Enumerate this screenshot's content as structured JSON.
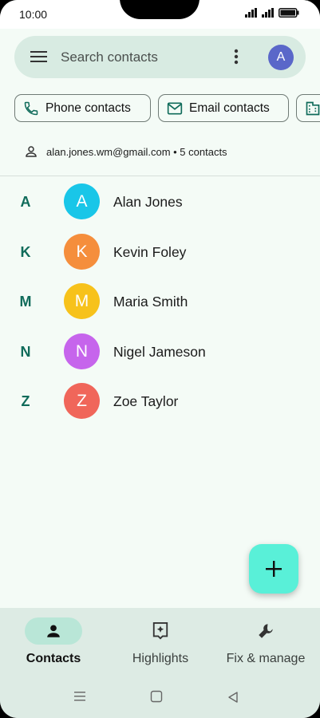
{
  "status": {
    "time": "10:00"
  },
  "search": {
    "placeholder": "Search contacts",
    "avatar_letter": "A"
  },
  "chips": [
    {
      "label": "Phone contacts",
      "icon": "phone-icon"
    },
    {
      "label": "Email contacts",
      "icon": "mail-icon"
    },
    {
      "label": "",
      "icon": "building-icon"
    }
  ],
  "account": {
    "text": "alan.jones.wm@gmail.com • 5 contacts"
  },
  "contacts": [
    {
      "letter": "A",
      "initial": "A",
      "name": "Alan Jones",
      "color": "#19c6e8"
    },
    {
      "letter": "K",
      "initial": "K",
      "name": "Kevin Foley",
      "color": "#f58e3c"
    },
    {
      "letter": "M",
      "initial": "M",
      "name": "Maria Smith",
      "color": "#f7c21b"
    },
    {
      "letter": "N",
      "initial": "N",
      "name": "Nigel Jameson",
      "color": "#c665ec"
    },
    {
      "letter": "Z",
      "initial": "Z",
      "name": "Zoe Taylor",
      "color": "#f0665a"
    }
  ],
  "nav": [
    {
      "label": "Contacts",
      "icon": "person-icon",
      "active": true
    },
    {
      "label": "Highlights",
      "icon": "highlights-icon",
      "active": false
    },
    {
      "label": "Fix & manage",
      "icon": "wrench-icon",
      "active": false
    }
  ],
  "colors": {
    "accent": "#0f6b5a",
    "fab": "#59f0d8",
    "nav_active": "#b9e6d7"
  }
}
